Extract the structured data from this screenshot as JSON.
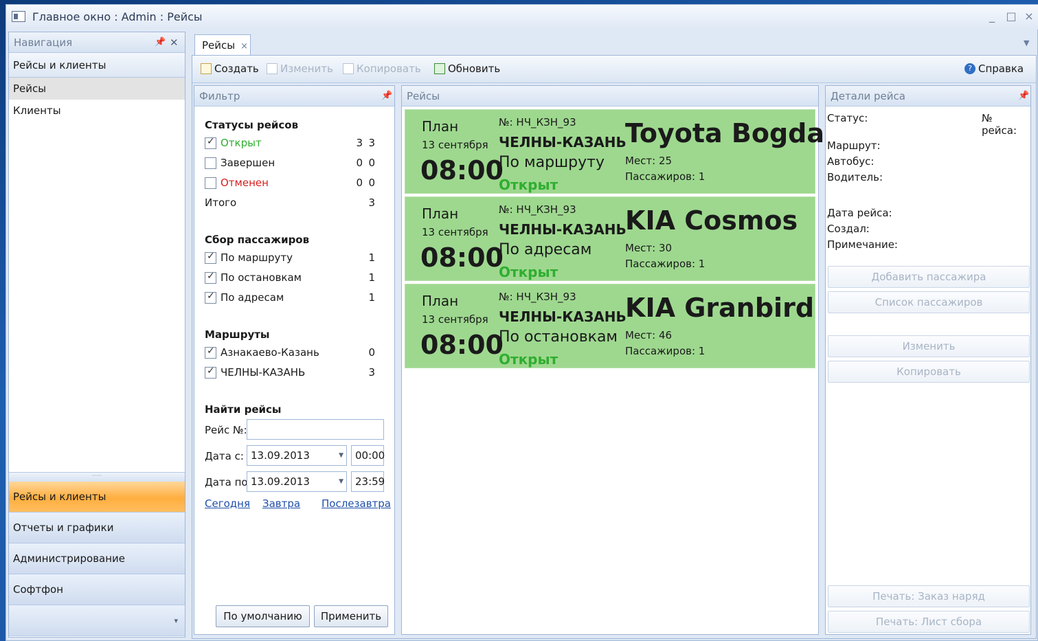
{
  "window": {
    "title": "Главное окно : Admin : Рейсы",
    "minimize": "_",
    "maximize": "□",
    "close": "×"
  },
  "nav": {
    "header": "Навигация",
    "group": "Рейсы и клиенты",
    "items": [
      {
        "label": "Рейсы"
      },
      {
        "label": "Клиенты"
      }
    ],
    "splitter": "·····",
    "buttons": [
      {
        "label": "Рейсы и клиенты"
      },
      {
        "label": "Отчеты и графики"
      },
      {
        "label": "Администрирование"
      },
      {
        "label": "Софтфон"
      }
    ],
    "expander": "▾"
  },
  "tab": {
    "label": "Рейсы",
    "close": "×"
  },
  "toolbar": {
    "create": "Создать",
    "edit": "Изменить",
    "copy": "Копировать",
    "refresh": "Обновить",
    "help": "Справка"
  },
  "filter": {
    "header": "Фильтр",
    "statuses_title": "Статусы рейсов",
    "statuses": [
      {
        "label": "Открыт",
        "count1": "3",
        "count2": "3",
        "checked": true,
        "color": "#2fae2f"
      },
      {
        "label": "Завершен",
        "count1": "0",
        "count2": "0",
        "checked": false,
        "color": "#1a1a1a"
      },
      {
        "label": "Отменен",
        "count1": "0",
        "count2": "0",
        "checked": false,
        "color": "#d62020"
      }
    ],
    "total_label": "Итого",
    "total_value": "3",
    "collection_title": "Сбор пассажиров",
    "collection": [
      {
        "label": "По маршруту",
        "count": "1",
        "checked": true
      },
      {
        "label": "По остановкам",
        "count": "1",
        "checked": true
      },
      {
        "label": "По адресам",
        "count": "1",
        "checked": true
      }
    ],
    "routes_title": "Маршруты",
    "routes": [
      {
        "label": "Азнакаево-Казань",
        "count": "0",
        "checked": true
      },
      {
        "label": "ЧЕЛНЫ-КАЗАНЬ",
        "count": "3",
        "checked": true
      }
    ],
    "find_title": "Найти рейсы",
    "trip_no_label": "Рейс №:",
    "trip_no_value": "",
    "date_from_label": "Дата с:",
    "date_from": "13.09.2013",
    "time_from": "00:00",
    "date_to_label": "Дата по:",
    "date_to": "13.09.2013",
    "time_to": "23:59",
    "links": [
      "Сегодня",
      "Завтра",
      "Послезавтра"
    ],
    "default_btn": "По умолчанию",
    "apply_btn": "Применить"
  },
  "trips": {
    "header": "Рейсы",
    "cards": [
      {
        "plan": "План",
        "date": "13 сентября",
        "time": "08:00",
        "number": "№: НЧ_КЗН_93",
        "route": "ЧЕЛНЫ-КАЗАНЬ",
        "collection": "По маршруту",
        "status": "Открыт",
        "bus": "Toyota Bogdan",
        "seats": "Мест:  25",
        "passengers": "Пассажиров:  1"
      },
      {
        "plan": "План",
        "date": "13 сентября",
        "time": "08:00",
        "number": "№: НЧ_КЗН_93",
        "route": "ЧЕЛНЫ-КАЗАНЬ",
        "collection": "По адресам",
        "status": "Открыт",
        "bus": "KIA Cosmos",
        "seats": "Мест:  30",
        "passengers": "Пассажиров:  1"
      },
      {
        "plan": "План",
        "date": "13 сентября",
        "time": "08:00",
        "number": "№: НЧ_КЗН_93",
        "route": "ЧЕЛНЫ-КАЗАНЬ",
        "collection": "По остановкам",
        "status": "Открыт",
        "bus": "KIA Granbird",
        "seats": "Мест:  46",
        "passengers": "Пассажиров:  1"
      }
    ],
    "card_color": "#9ed88f"
  },
  "details": {
    "header": "Детали рейса",
    "status_label": "Статус:",
    "number_label": "№ рейса:",
    "route_label": "Маршрут:",
    "bus_label": "Автобус:",
    "driver_label": "Водитель:",
    "date_label": "Дата рейса:",
    "created_label": "Создал:",
    "note_label": "Примечание:",
    "btn_add_passenger": "Добавить пассажира",
    "btn_passenger_list": "Список пассажиров",
    "btn_edit": "Изменить",
    "btn_copy": "Копировать",
    "btn_print_order": "Печать: Заказ наряд",
    "btn_print_sheet": "Печать: Лист сбора"
  }
}
